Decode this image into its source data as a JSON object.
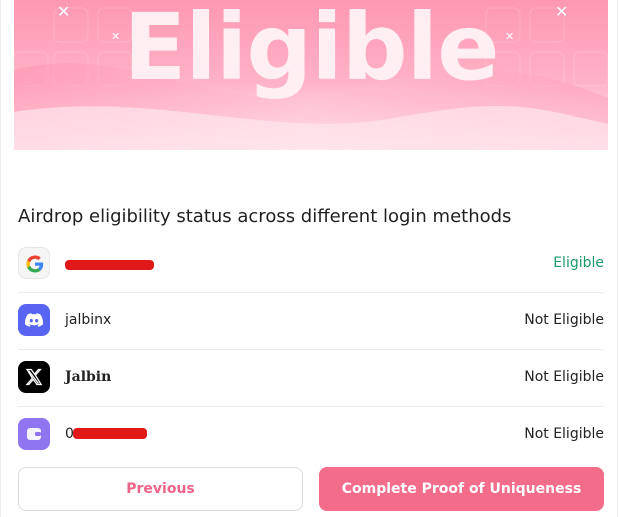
{
  "banner": {
    "title": "Eligible"
  },
  "heading": "Airdrop eligibility status across different login methods",
  "accounts": [
    {
      "provider": "google",
      "icon": "google-icon",
      "name": "",
      "redacted": true,
      "status": "Eligible",
      "status_color": "#1a9b68"
    },
    {
      "provider": "discord",
      "icon": "discord-icon",
      "name": "jalbinx",
      "redacted": false,
      "status": "Not Eligible"
    },
    {
      "provider": "x",
      "icon": "x-icon",
      "name": "Jalbin",
      "redacted": false,
      "status": "Not Eligible"
    },
    {
      "provider": "wallet",
      "icon": "wallet-icon",
      "name": "0",
      "redacted": true,
      "status": "Not Eligible"
    }
  ],
  "buttons": {
    "previous": "Previous",
    "complete": "Complete Proof of Uniqueness"
  },
  "colors": {
    "accent": "#f36d8b",
    "eligible": "#1a9b68",
    "discord": "#5865F2",
    "wallet": "#8f75f0"
  }
}
